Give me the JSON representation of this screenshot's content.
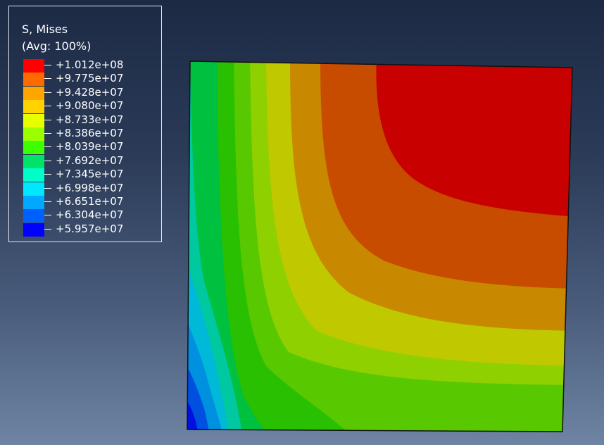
{
  "legend": {
    "title": "S, Mises",
    "subtitle": "(Avg: 100%)",
    "labels": [
      "+1.012e+08",
      "+9.775e+07",
      "+9.428e+07",
      "+9.080e+07",
      "+8.733e+07",
      "+8.386e+07",
      "+8.039e+07",
      "+7.692e+07",
      "+7.345e+07",
      "+6.998e+07",
      "+6.651e+07",
      "+6.304e+07",
      "+5.957e+07"
    ],
    "colors": [
      "#ff0000",
      "#ff6a00",
      "#ffa500",
      "#ffd200",
      "#e8ff00",
      "#9cff00",
      "#3cff00",
      "#00e26a",
      "#00ffc8",
      "#00e8ff",
      "#00a8ff",
      "#0060ff",
      "#0000ff"
    ]
  },
  "contour": {
    "band_colors": [
      "#c80000",
      "#c84c00",
      "#c88800",
      "#c0c800",
      "#8ed000",
      "#58c800",
      "#28c000",
      "#00c040",
      "#00c8a0",
      "#00b8d8",
      "#0090e0",
      "#0050e0",
      "#0010e0"
    ]
  }
}
